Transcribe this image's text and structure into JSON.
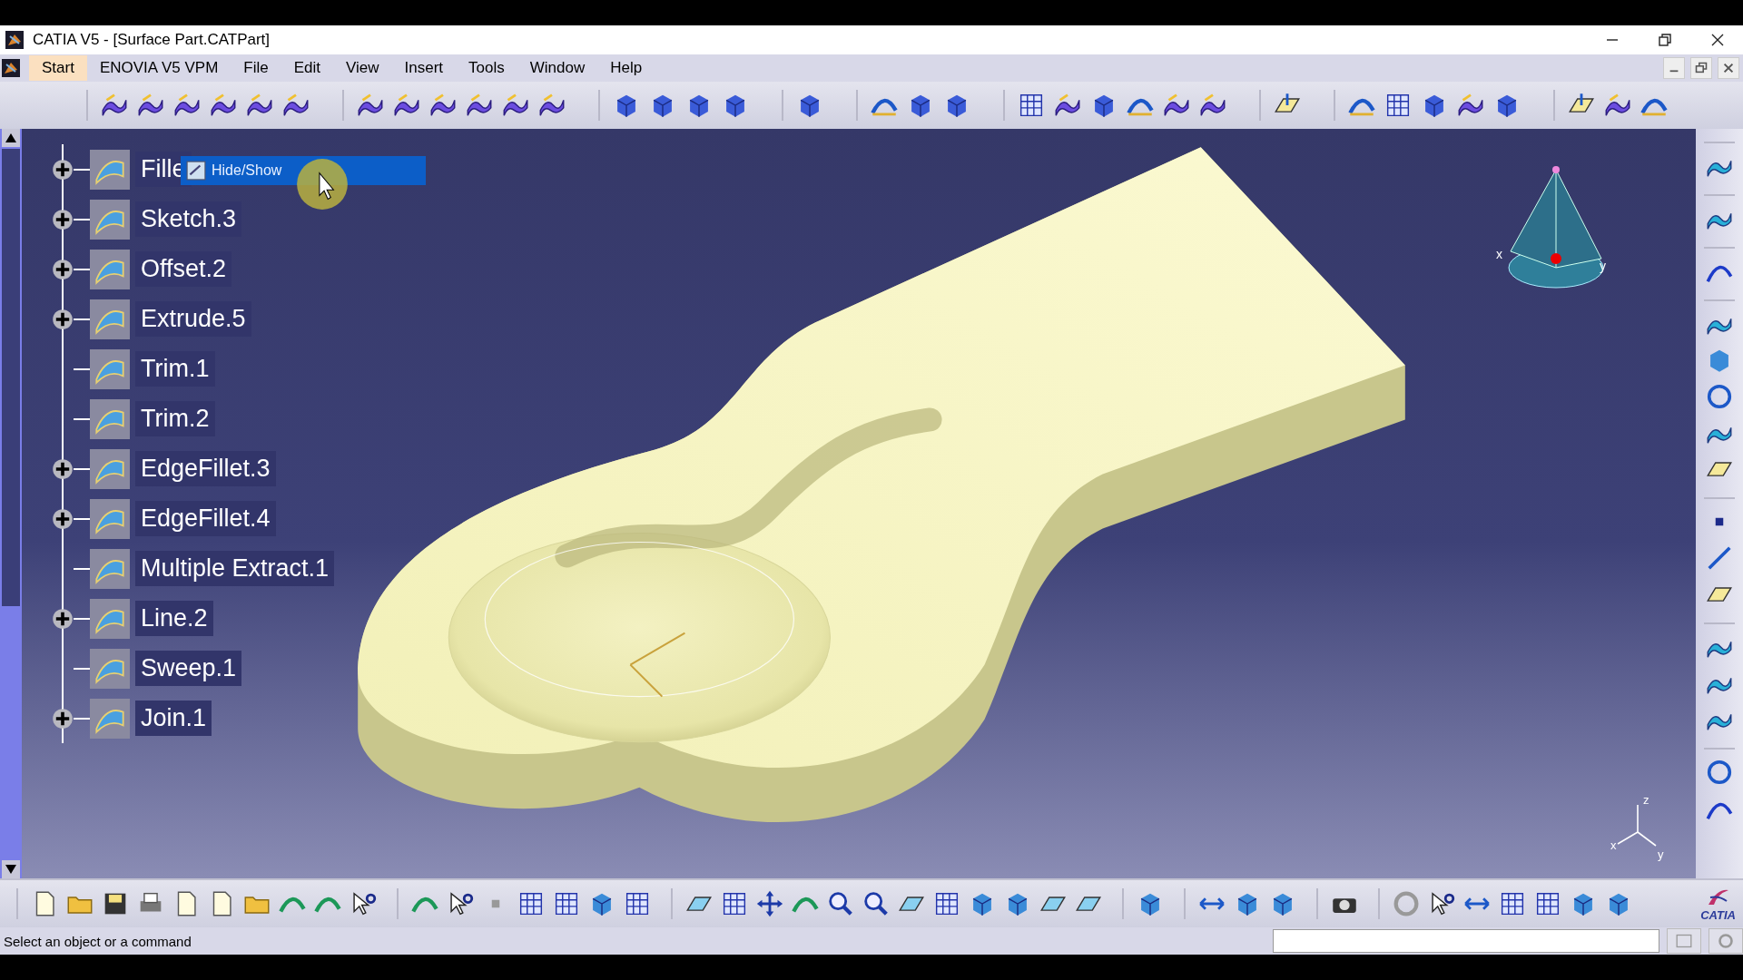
{
  "window": {
    "title": "CATIA V5 - [Surface Part.CATPart]"
  },
  "menu": [
    {
      "label": "Start",
      "selected": true
    },
    {
      "label": "ENOVIA V5 VPM",
      "selected": false
    },
    {
      "label": "File",
      "selected": false
    },
    {
      "label": "Edit",
      "selected": false
    },
    {
      "label": "View",
      "selected": false
    },
    {
      "label": "Insert",
      "selected": false
    },
    {
      "label": "Tools",
      "selected": false
    },
    {
      "label": "Window",
      "selected": false
    },
    {
      "label": "Help",
      "selected": false
    }
  ],
  "tree": {
    "items": [
      {
        "label": "Fille",
        "expandable": true
      },
      {
        "label": "Sketch.3",
        "expandable": true
      },
      {
        "label": "Offset.2",
        "expandable": true
      },
      {
        "label": "Extrude.5",
        "expandable": true
      },
      {
        "label": "Trim.1",
        "expandable": false
      },
      {
        "label": "Trim.2",
        "expandable": false
      },
      {
        "label": "EdgeFillet.3",
        "expandable": true
      },
      {
        "label": "EdgeFillet.4",
        "expandable": true
      },
      {
        "label": "Multiple Extract.1",
        "expandable": false
      },
      {
        "label": "Line.2",
        "expandable": true
      },
      {
        "label": "Sweep.1",
        "expandable": false
      },
      {
        "label": "Join.1",
        "expandable": true
      }
    ]
  },
  "context_menu": {
    "items": [
      {
        "label": "Hide/Show",
        "selected": true
      }
    ]
  },
  "compass": {
    "labels": [
      "x",
      "y"
    ]
  },
  "axis_triad": {
    "labels": [
      "z",
      "x",
      "y"
    ]
  },
  "logo": {
    "text": "CATIA"
  },
  "status_bar": {
    "message": "Select an object or a command"
  }
}
